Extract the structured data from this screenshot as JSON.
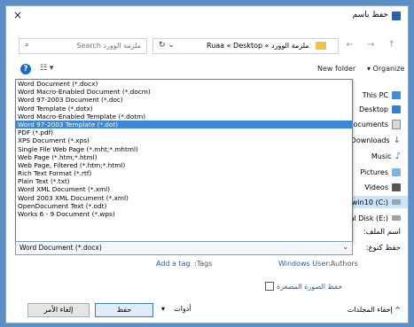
{
  "window": {
    "title": "حفظ باسم",
    "close_glyph": "×"
  },
  "address_bar": {
    "nav_glyphs": "← → ↑",
    "path": "Ruaa « Desktop « ملزمة الوورد",
    "path_sep": "»",
    "refresh_glyph": "↻ ⌄",
    "search_placeholder": "Search ملزمة الوورد",
    "search_glyph": "⌕"
  },
  "toolbar": {
    "help": "?",
    "view": "☷ ▾",
    "new_folder": "New folder",
    "organize": "▾ Organize"
  },
  "sidebar": {
    "items": [
      {
        "label": "This PC",
        "icon": "monitor-icon",
        "color": "#3b8de0"
      },
      {
        "label": "Desktop",
        "icon": "desktop-icon",
        "color": "#2f7fd6"
      },
      {
        "label": "Documents",
        "icon": "documents-icon",
        "color": "#d9d9d9"
      },
      {
        "label": "Downloads",
        "icon": "download-icon",
        "color": "#2b73c9"
      },
      {
        "label": "Music",
        "icon": "music-icon",
        "color": "#2b73c9"
      },
      {
        "label": "Pictures",
        "icon": "pictures-icon",
        "color": "#7fb3e0"
      },
      {
        "label": "Videos",
        "icon": "videos-icon",
        "color": "#555555"
      },
      {
        "label": "win10 (C:)",
        "icon": "drive-icon",
        "color": "#9aa4ad"
      },
      {
        "label": "Local Disk (E:)",
        "icon": "drive-icon",
        "color": "#9aa4ad"
      }
    ]
  },
  "dropdown": {
    "selected_index": 5,
    "options": [
      "Word Document (*.docx)",
      "Word Macro-Enabled Document (*.docm)",
      "Word 97-2003 Document (*.doc)",
      "Word Template (*.dotx)",
      "Word Macro-Enabled Template (*.dotm)",
      "Word 97-2003 Template (*.dot)",
      "PDF (*.pdf)",
      "XPS Document (*.xps)",
      "Single File Web Page (*.mht;*.mhtml)",
      "Web Page (*.htm;*.html)",
      "Web Page, Filtered (*.htm;*.html)",
      "Rich Text Format (*.rtf)",
      "Plain Text (*.txt)",
      "Word XML Document (*.xml)",
      "Word 2003 XML Document (*.xml)",
      "OpenDocument Text (*.odt)",
      "Works 6 - 9 Document (*.wps)"
    ]
  },
  "fields": {
    "filename_label": "اسم الملف:",
    "type_label": "حفظ كنوع:",
    "type_value": "Word Document (*.docx)",
    "type_arrow": "⌄"
  },
  "meta": {
    "tags_label": ":Tags",
    "tags_value": "Add a tag",
    "authors_label": ":Authors",
    "authors_value": "Windows User"
  },
  "thumbnail": {
    "label": "حفظ الصورة المصغرة"
  },
  "footer": {
    "hide_folders": "إخفاء المجلدات",
    "hide_glyph": "^",
    "tools": "أدوات",
    "tools_arrow": "▾",
    "save": "حفظ",
    "cancel": "إلغاء الأمر"
  },
  "colors": {
    "accent": "#3b86d8",
    "link": "#1d5fb8",
    "background": "#5b8fc6"
  }
}
